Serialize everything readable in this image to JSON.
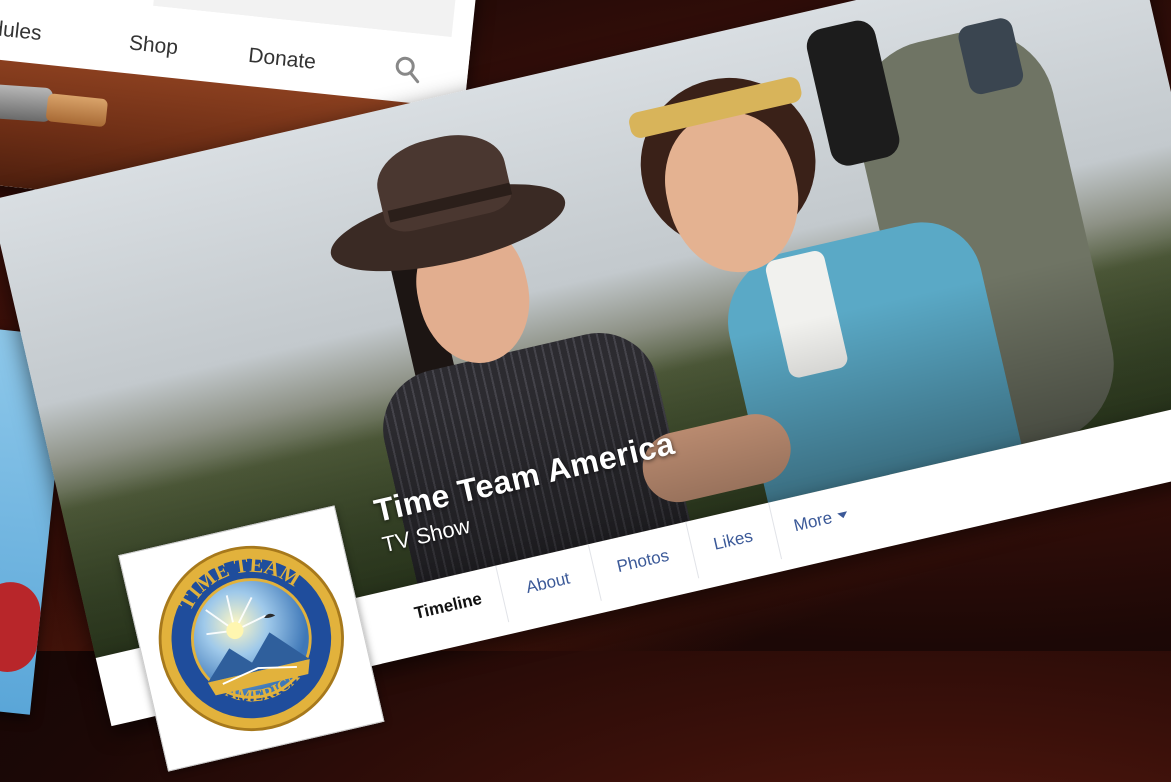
{
  "nav": {
    "items": [
      "edules",
      "Shop",
      "Donate"
    ],
    "search_icon": "search-icon"
  },
  "page": {
    "name": "Time Team America",
    "category": "TV Show",
    "logo": {
      "top_text": "TIME TEAM",
      "bottom_text": "AMERICA"
    }
  },
  "tabs": [
    {
      "label": "Timeline"
    },
    {
      "label": "About"
    },
    {
      "label": "Photos"
    },
    {
      "label": "Likes"
    },
    {
      "label": "More"
    }
  ],
  "colors": {
    "fb_link": "#3b5998",
    "logo_blue": "#1f4d9c",
    "logo_gold": "#e2b23c"
  }
}
